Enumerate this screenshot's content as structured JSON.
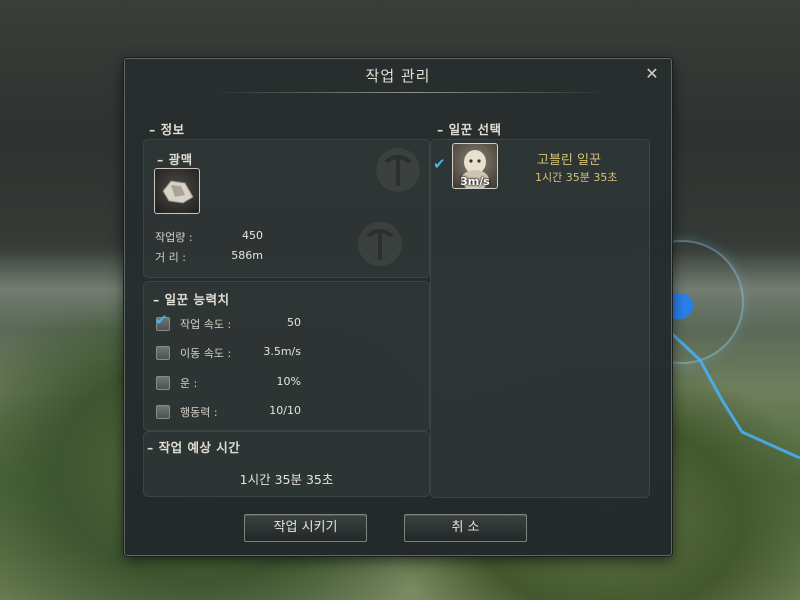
{
  "dialog": {
    "title": "작업 관리",
    "close_icon": "close-icon"
  },
  "info": {
    "header": "– 정보",
    "node_name": "– 광맥",
    "node_icon": "ore-icon",
    "work_amount_label": "작업량 :",
    "work_amount_value": "450",
    "distance_label": "거  리 :",
    "distance_value": "586m"
  },
  "stats": {
    "header": "– 일꾼 능력치",
    "items": [
      {
        "label": "작업 속도 :",
        "value": "50",
        "checked": true
      },
      {
        "label": "이동 속도 :",
        "value": "3.5m/s",
        "checked": false
      },
      {
        "label": "운 :",
        "value": "10%",
        "checked": false
      },
      {
        "label": "행동력 :",
        "value": "10/10",
        "checked": false
      }
    ]
  },
  "eta": {
    "header": "– 작업 예상 시간",
    "value": "1시간 35분 35초"
  },
  "workers": {
    "header": "– 일꾼 선택",
    "list": [
      {
        "name": "고블린 일꾼",
        "time": "1시간 35분 35초",
        "badge": "3m/s",
        "checked": true,
        "icon": "goblin-worker-icon"
      }
    ]
  },
  "buttons": {
    "confirm": "작업 시키기",
    "cancel": "취 소"
  },
  "colors": {
    "accent_check": "#3fb6e6",
    "worker_name": "#d8c27a",
    "map_marker": "#2a7fe8"
  }
}
